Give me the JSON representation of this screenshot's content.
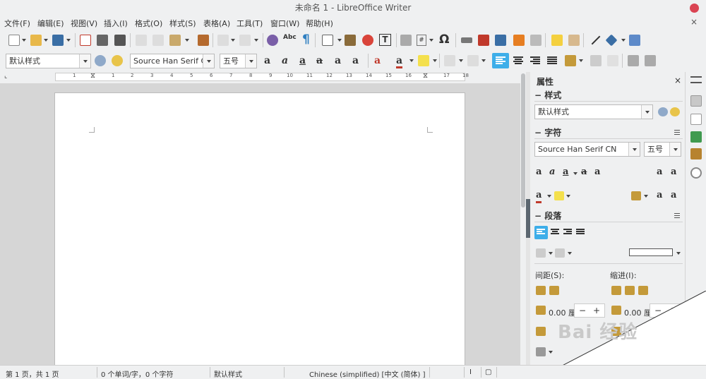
{
  "window": {
    "title": "未命名 1 - LibreOffice Writer",
    "close_color": "#da4453"
  },
  "menu": {
    "items": [
      "文件(F)",
      "编辑(E)",
      "视图(V)",
      "插入(I)",
      "格式(O)",
      "样式(S)",
      "表格(A)",
      "工具(T)",
      "窗口(W)",
      "帮助(H)"
    ],
    "close_doc": "×"
  },
  "toolbar": {
    "style_combo": "默认样式",
    "font_name": "Source Han Serif C",
    "font_size": "五号",
    "special_char": "Ω",
    "text_box": "T",
    "field": "#",
    "spellcheck": "Abc",
    "formatting_marks": "¶",
    "accent": "#3daee9"
  },
  "ruler": {
    "marks": [
      "1",
      "1",
      "2",
      "3",
      "4",
      "5",
      "6",
      "7",
      "8",
      "9",
      "10",
      "11",
      "12",
      "13",
      "14",
      "15",
      "16",
      "17",
      "18"
    ]
  },
  "sidebar": {
    "title": "属性",
    "close": "×",
    "styles_section": "样式",
    "para_style": "默认样式",
    "char_section": "字符",
    "font_name": "Source Han Serif CN",
    "font_size": "五号",
    "para_section": "段落",
    "spacing_label": "间距(S):",
    "indent_label": "缩进(I):",
    "spacing_value": "0.00 厘",
    "indent_value": "0.00 厘",
    "minus": "−",
    "plus": "+"
  },
  "status": {
    "page": "第 1 页，共 1 页",
    "words": "0 个单词/字，0 个字符",
    "style": "默认样式",
    "language": "Chinese (simplified) [中文 (简体) ]",
    "insert_mode": "I",
    "selection_mode": "▢"
  },
  "watermark": "Bai 经验"
}
